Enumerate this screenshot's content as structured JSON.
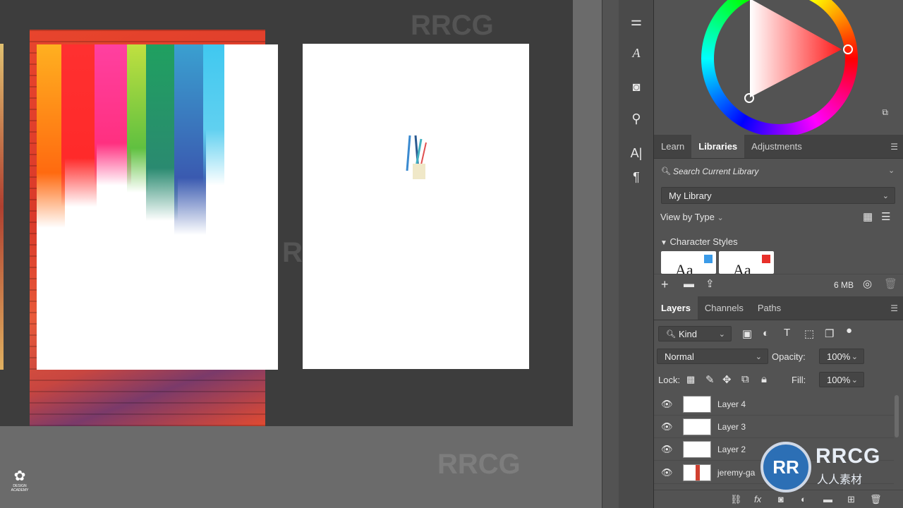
{
  "color_panel": {
    "accent_colors": [
      "#ff0000",
      "#ff00ff",
      "#0000ff",
      "#00ffff",
      "#00ff00",
      "#ffff00"
    ]
  },
  "tools": [
    "adjust-sliders-icon",
    "type-glyph-icon",
    "camera-icon",
    "stamp-icon",
    "character-icon",
    "paragraph-icon"
  ],
  "libraries_tabs": [
    "Learn",
    "Libraries",
    "Adjustments"
  ],
  "libraries": {
    "search_placeholder": "Search Current Library",
    "library_select": "My Library",
    "view_by": "View by Type",
    "section_title": "Character Styles",
    "cards": [
      {
        "label": "Aa",
        "swatch": "#3b9be8"
      },
      {
        "label": "Aa",
        "swatch": "#e8302a"
      }
    ],
    "size": "6 MB"
  },
  "layers_tabs": [
    "Layers",
    "Channels",
    "Paths"
  ],
  "layers_panel": {
    "kind_filter": "Kind",
    "blend_mode": "Normal",
    "opacity_label": "Opacity:",
    "opacity_value": "100%",
    "lock_label": "Lock:",
    "fill_label": "Fill:",
    "fill_value": "100%",
    "layers": [
      {
        "name": "Layer 4"
      },
      {
        "name": "Layer 3"
      },
      {
        "name": "Layer 2"
      },
      {
        "name": "jeremy-ga"
      }
    ]
  },
  "bottom_bar": {
    "fx_label": "fx"
  },
  "watermark": {
    "brand": "RRCG",
    "subtitle": "人人素材"
  },
  "logo": {
    "text": "DESIGN ACADEMY"
  }
}
